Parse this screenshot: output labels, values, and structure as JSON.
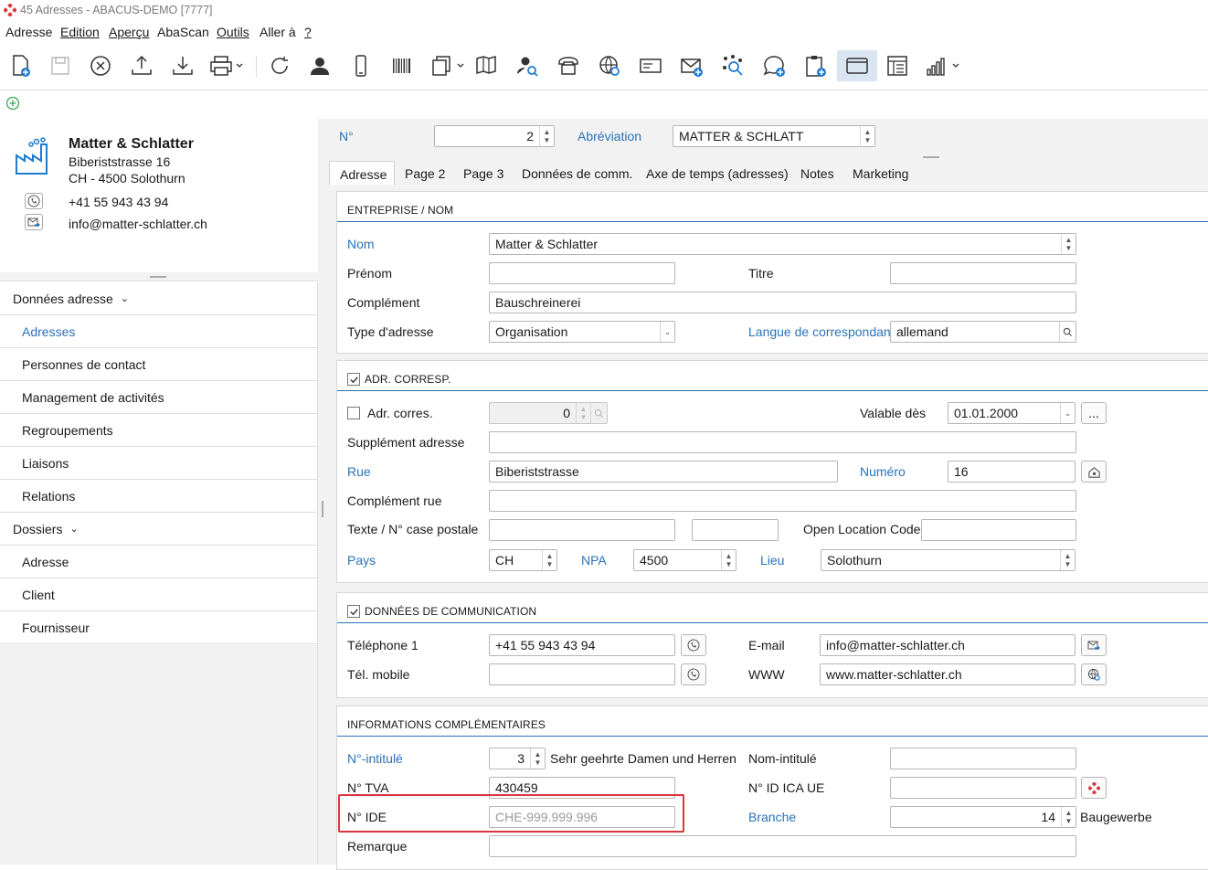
{
  "window": {
    "title": "45 Adresses - ABACUS-DEMO [7777]"
  },
  "menu": [
    {
      "label": "Adresse",
      "u": false
    },
    {
      "label": "Edition",
      "u": true
    },
    {
      "label": "Aperçu",
      "u": true
    },
    {
      "label": "AbaScan",
      "u": false
    },
    {
      "label": "Outils",
      "u": true
    },
    {
      "label": "Aller à",
      "u": false
    },
    {
      "label": "?",
      "u": true
    }
  ],
  "toolbar": {
    "icons": [
      "new-document-icon",
      "save-icon",
      "cancel-icon",
      "upload-icon",
      "download-icon",
      "print-icon",
      "refresh-icon",
      "person-icon",
      "mobile-icon",
      "barcode-icon",
      "copy-documents-icon",
      "map-book-icon",
      "person-search-icon",
      "telephone-icon",
      "web-search-icon",
      "card-icon",
      "email-add-icon",
      "network-search-icon",
      "chat-add-icon",
      "clipboard-add-icon",
      "window-icon",
      "layout-icon",
      "chart-icon"
    ]
  },
  "contact_card": {
    "company": "Matter & Schlatter",
    "street": "Biberiststrasse 16",
    "city": "CH - 4500 Solothurn",
    "phone": "+41 55 943 43 94",
    "email": "info@matter-schlatter.ch"
  },
  "nav": {
    "group1": "Données adresse",
    "group1_items": [
      "Adresses",
      "Personnes de contact",
      "Management de activités",
      "Regroupements",
      "Liaisons",
      "Relations"
    ],
    "group2": "Dossiers",
    "group2_items": [
      "Adresse",
      "Client",
      "Fournisseur"
    ]
  },
  "header": {
    "no_label": "N°",
    "no_value": "2",
    "abbr_label": "Abréviation",
    "abbr_value": "MATTER & SCHLATT"
  },
  "tabs": [
    "Adresse",
    "Page 2",
    "Page 3",
    "Données de comm.",
    "Axe de temps (adresses)",
    "Notes",
    "Marketing"
  ],
  "section_company": {
    "title": "ENTREPRISE / NOM",
    "nom_label": "Nom",
    "nom_value": "Matter & Schlatter",
    "prenom_label": "Prénom",
    "prenom_value": "",
    "titre_label": "Titre",
    "titre_value": "",
    "complement_label": "Complément",
    "complement_value": "Bauschreinerei",
    "type_label": "Type d'adresse",
    "type_value": "Organisation",
    "langue_label": "Langue de correspondance",
    "langue_value": "allemand"
  },
  "section_addr": {
    "title": "ADR. CORRESP.",
    "adrcorres_label": "Adr. corres.",
    "adrcorres_value": "0",
    "valable_label": "Valable dès",
    "valable_value": "01.01.2000",
    "more_label": "...",
    "suppl_label": "Supplément adresse",
    "suppl_value": "",
    "rue_label": "Rue",
    "rue_value": "Biberiststrasse",
    "numero_label": "Numéro",
    "numero_value": "16",
    "complrue_label": "Complément rue",
    "complrue_value": "",
    "texte_label": "Texte / N° case postale",
    "texte_value": "",
    "case_value": "",
    "olc_label": "Open Location Code",
    "olc_value": "",
    "pays_label": "Pays",
    "pays_value": "CH",
    "npa_label": "NPA",
    "npa_value": "4500",
    "lieu_label": "Lieu",
    "lieu_value": "Solothurn"
  },
  "section_comm": {
    "title": "DONNÉES DE COMMUNICATION",
    "tel_label": "Téléphone 1",
    "tel_value": "+41 55 943 43 94",
    "email_label": "E-mail",
    "email_value": "info@matter-schlatter.ch",
    "mobile_label": "Tél. mobile",
    "mobile_value": "",
    "www_label": "WWW",
    "www_value": "www.matter-schlatter.ch"
  },
  "section_info": {
    "title": "INFORMATIONS COMPLÉMENTAIRES",
    "intitule_label": "N°-intitulé",
    "intitule_value": "3",
    "intitule_text": "Sehr geehrte Damen und Herren",
    "nomintitule_label": "Nom-intitulé",
    "nomintitule_value": "",
    "tva_label": "N° TVA",
    "tva_value": "430459",
    "ica_label": "N° ID ICA UE",
    "ica_value": "",
    "ide_label": "N° IDE",
    "ide_placeholder": "CHE-999.999.996",
    "branche_label": "Branche",
    "branche_value": "14",
    "branche_text": "Baugewerbe",
    "remarque_label": "Remarque",
    "remarque_value": ""
  },
  "colors": {
    "accent": "#2a72b8",
    "highlight": "#d9363e",
    "icon_blue": "#1e7bd0"
  }
}
